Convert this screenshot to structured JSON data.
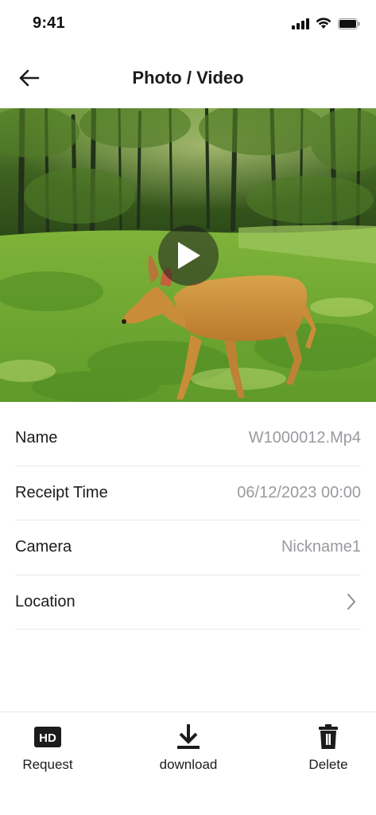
{
  "status_bar": {
    "time": "9:41"
  },
  "header": {
    "title": "Photo / Video"
  },
  "media": {
    "type": "video"
  },
  "details": {
    "name": {
      "label": "Name",
      "value": "W1000012.Mp4"
    },
    "receipt_time": {
      "label": "Receipt Time",
      "value": "06/12/2023 00:00"
    },
    "camera": {
      "label": "Camera",
      "value": "Nickname1"
    },
    "location": {
      "label": "Location"
    }
  },
  "actions": {
    "request": {
      "label": "Request",
      "icon": "hd-icon"
    },
    "download": {
      "label": "download",
      "icon": "download-icon"
    },
    "delete": {
      "label": "Delete",
      "icon": "trash-icon"
    }
  },
  "colors": {
    "text": "#1c1c1e",
    "secondary_text": "#9a9aa0",
    "divider": "#e9e9ec"
  }
}
